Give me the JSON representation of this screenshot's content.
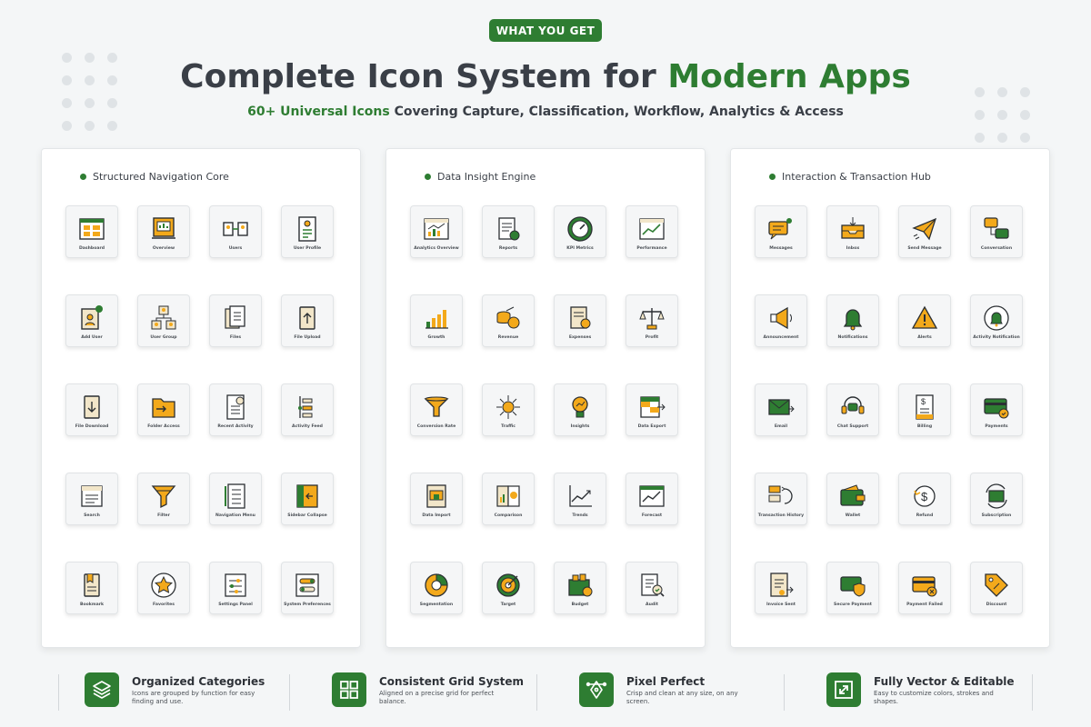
{
  "badge": "WHAT YOU GET",
  "headline": {
    "prefix": "Complete Icon System for ",
    "accent": "Modern Apps"
  },
  "subline": {
    "accent": "60+ Universal Icons",
    "rest": " Covering Capture, Classification, Workflow, Analytics & Access"
  },
  "colors": {
    "accent": "#2e7d32",
    "icon_fill": "#f3a91b",
    "icon_stroke": "#2b2f33",
    "icon_bg": "#f2e6c9"
  },
  "panels": [
    {
      "title": "Structured Navigation Core",
      "icons": [
        {
          "label": "Dashboard",
          "icon": "dashboard-icon"
        },
        {
          "label": "Overview",
          "icon": "overview-icon"
        },
        {
          "label": "Users",
          "icon": "users-icon"
        },
        {
          "label": "User Profile",
          "icon": "user-profile-icon"
        },
        {
          "label": "Add User",
          "icon": "add-user-icon"
        },
        {
          "label": "User Group",
          "icon": "user-group-icon"
        },
        {
          "label": "Files",
          "icon": "files-icon"
        },
        {
          "label": "File Upload",
          "icon": "file-upload-icon"
        },
        {
          "label": "File Download",
          "icon": "file-download-icon"
        },
        {
          "label": "Folder Access",
          "icon": "folder-access-icon"
        },
        {
          "label": "Recent Activity",
          "icon": "recent-activity-icon"
        },
        {
          "label": "Activity Feed",
          "icon": "activity-feed-icon"
        },
        {
          "label": "Search",
          "icon": "search-icon"
        },
        {
          "label": "Filter",
          "icon": "filter-icon"
        },
        {
          "label": "Navigation Menu",
          "icon": "navigation-menu-icon"
        },
        {
          "label": "Sidebar Collapse",
          "icon": "sidebar-collapse-icon"
        },
        {
          "label": "Bookmark",
          "icon": "bookmark-icon"
        },
        {
          "label": "Favorites",
          "icon": "favorites-icon"
        },
        {
          "label": "Settings Panel",
          "icon": "settings-panel-icon"
        },
        {
          "label": "System Preferences",
          "icon": "system-preferences-icon"
        }
      ]
    },
    {
      "title": "Data Insight Engine",
      "icons": [
        {
          "label": "Analytics Overview",
          "icon": "analytics-overview-icon"
        },
        {
          "label": "Reports",
          "icon": "reports-icon"
        },
        {
          "label": "KPI Metrics",
          "icon": "kpi-metrics-icon"
        },
        {
          "label": "Performance",
          "icon": "performance-icon"
        },
        {
          "label": "Growth",
          "icon": "growth-icon"
        },
        {
          "label": "Revenue",
          "icon": "revenue-icon"
        },
        {
          "label": "Expenses",
          "icon": "expenses-icon"
        },
        {
          "label": "Profit",
          "icon": "profit-icon"
        },
        {
          "label": "Conversion Rate",
          "icon": "conversion-rate-icon"
        },
        {
          "label": "Traffic",
          "icon": "traffic-icon"
        },
        {
          "label": "Insights",
          "icon": "insights-icon"
        },
        {
          "label": "Data Export",
          "icon": "data-export-icon"
        },
        {
          "label": "Data Import",
          "icon": "data-import-icon"
        },
        {
          "label": "Comparison",
          "icon": "comparison-icon"
        },
        {
          "label": "Trends",
          "icon": "trends-icon"
        },
        {
          "label": "Forecast",
          "icon": "forecast-icon"
        },
        {
          "label": "Segmentation",
          "icon": "segmentation-icon"
        },
        {
          "label": "Target",
          "icon": "target-icon"
        },
        {
          "label": "Budget",
          "icon": "budget-icon"
        },
        {
          "label": "Audit",
          "icon": "audit-icon"
        }
      ]
    },
    {
      "title": "Interaction & Transaction Hub",
      "icons": [
        {
          "label": "Messages",
          "icon": "messages-icon"
        },
        {
          "label": "Inbox",
          "icon": "inbox-icon"
        },
        {
          "label": "Send Message",
          "icon": "send-message-icon"
        },
        {
          "label": "Conversation",
          "icon": "conversation-icon"
        },
        {
          "label": "Announcement",
          "icon": "announcement-icon"
        },
        {
          "label": "Notifications",
          "icon": "notifications-icon"
        },
        {
          "label": "Alerts",
          "icon": "alerts-icon"
        },
        {
          "label": "Activity Notification",
          "icon": "activity-notification-icon"
        },
        {
          "label": "Email",
          "icon": "email-icon"
        },
        {
          "label": "Chat Support",
          "icon": "chat-support-icon"
        },
        {
          "label": "Billing",
          "icon": "billing-icon"
        },
        {
          "label": "Payments",
          "icon": "payments-icon"
        },
        {
          "label": "Transaction History",
          "icon": "transaction-history-icon"
        },
        {
          "label": "Wallet",
          "icon": "wallet-icon"
        },
        {
          "label": "Refund",
          "icon": "refund-icon"
        },
        {
          "label": "Subscription",
          "icon": "subscription-icon"
        },
        {
          "label": "Invoice Sent",
          "icon": "invoice-sent-icon"
        },
        {
          "label": "Secure Payment",
          "icon": "secure-payment-icon"
        },
        {
          "label": "Payment Failed",
          "icon": "payment-failed-icon"
        },
        {
          "label": "Discount",
          "icon": "discount-icon"
        }
      ]
    }
  ],
  "features": [
    {
      "title": "Organized Categories",
      "desc": "Icons are grouped by function for easy finding and use.",
      "icon": "layers-icon"
    },
    {
      "title": "Consistent Grid System",
      "desc": "Aligned on a precise grid for perfect balance.",
      "icon": "grid-icon"
    },
    {
      "title": "Pixel Perfect",
      "desc": "Crisp and clean at any size, on any screen.",
      "icon": "pen-tool-icon"
    },
    {
      "title": "Fully Vector & Editable",
      "desc": "Easy to customize colors, strokes and shapes.",
      "icon": "resize-icon"
    }
  ]
}
